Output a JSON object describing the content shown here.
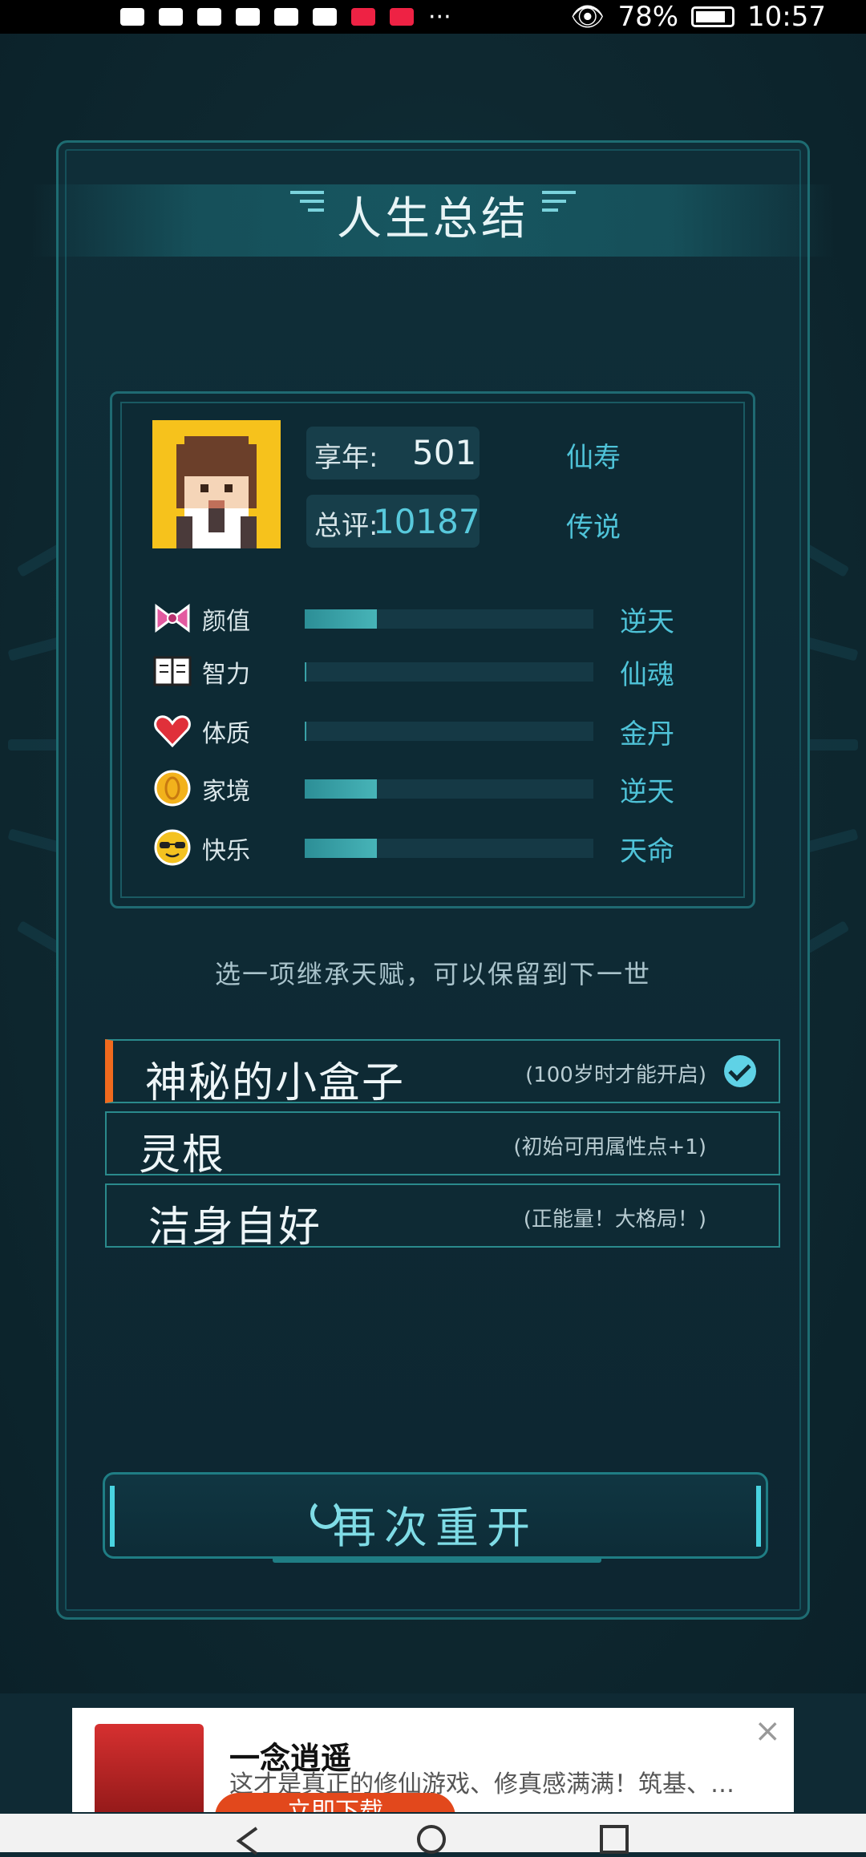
{
  "status_bar": {
    "left_icons": [
      "hd-icon",
      "signal-icon",
      "wifi-icon",
      "alarm-icon",
      "huawei-icon",
      "wechat-icon",
      "huawei-icon",
      "app-icon",
      "more-icon"
    ],
    "battery": "78%",
    "time": "10:57"
  },
  "title": "人生总结",
  "summary": {
    "age_label": "享年:",
    "age_value": "501",
    "age_grade": "仙寿",
    "score_label": "总评:",
    "score_value": "10187",
    "score_grade": "传说"
  },
  "attributes": [
    {
      "name": "颜值",
      "icon": "bow-icon",
      "fill": 0.25,
      "grade": "逆天"
    },
    {
      "name": "智力",
      "icon": "book-icon",
      "fill": 0.0,
      "grade": "仙魂"
    },
    {
      "name": "体质",
      "icon": "heart-icon",
      "fill": 0.0,
      "grade": "金丹"
    },
    {
      "name": "家境",
      "icon": "coin-icon",
      "fill": 0.25,
      "grade": "逆天"
    },
    {
      "name": "快乐",
      "icon": "sunglasses-icon",
      "fill": 0.25,
      "grade": "天命"
    }
  ],
  "hint": "选一项继承天赋，可以保留到下一世",
  "talents": [
    {
      "name": "神秘的小盒子",
      "desc": "(100岁时才能开启)",
      "selected": true
    },
    {
      "name": "灵根",
      "desc": "(初始可用属性点+1)",
      "selected": false
    },
    {
      "name": "洁身自好",
      "desc": "(正能量！大格局！)",
      "selected": false
    }
  ],
  "restart_label": "再次重开",
  "ad": {
    "title": "一念逍遥",
    "desc": "这才是真正的修仙游戏、修真感满满！筑基、…",
    "button": "立即下载"
  },
  "colors": {
    "background": "#0f2a34",
    "accent": "#4fc3d8",
    "bar_fill": "#47b4b8",
    "selected_marker": "#f06a1e"
  }
}
